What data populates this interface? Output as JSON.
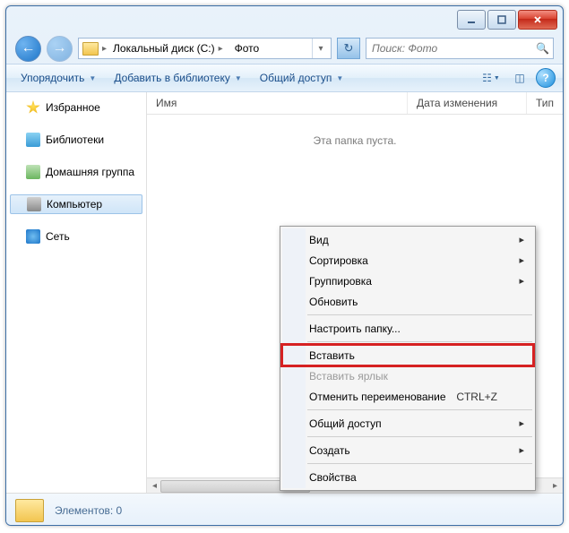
{
  "window": {
    "title": ""
  },
  "nav": {
    "crumbs": [
      {
        "label": "Локальный диск (C:)"
      },
      {
        "label": "Фото"
      }
    ],
    "search_placeholder": "Поиск: Фото"
  },
  "toolbar": {
    "organize_label": "Упорядочить",
    "addlib_label": "Добавить в библиотеку",
    "share_label": "Общий доступ"
  },
  "sidebar": {
    "items": [
      {
        "label": "Избранное",
        "icon": "fav"
      },
      {
        "label": "Библиотеки",
        "icon": "lib"
      },
      {
        "label": "Домашняя группа",
        "icon": "home"
      },
      {
        "label": "Компьютер",
        "icon": "comp",
        "selected": true
      },
      {
        "label": "Сеть",
        "icon": "net"
      }
    ]
  },
  "columns": {
    "name": "Имя",
    "date": "Дата изменения",
    "type": "Тип"
  },
  "content": {
    "empty_text": "Эта папка пуста."
  },
  "statusbar": {
    "text": "Элементов: 0"
  },
  "context_menu": {
    "items": [
      {
        "label": "Вид",
        "submenu": true
      },
      {
        "label": "Сортировка",
        "submenu": true
      },
      {
        "label": "Группировка",
        "submenu": true
      },
      {
        "label": "Обновить"
      },
      {
        "sep": true
      },
      {
        "label": "Настроить папку..."
      },
      {
        "sep": true
      },
      {
        "label": "Вставить",
        "highlight": true
      },
      {
        "label": "Вставить ярлык",
        "disabled": true
      },
      {
        "label": "Отменить переименование",
        "shortcut": "CTRL+Z"
      },
      {
        "sep": true
      },
      {
        "label": "Общий доступ",
        "submenu": true
      },
      {
        "sep": true
      },
      {
        "label": "Создать",
        "submenu": true
      },
      {
        "sep": true
      },
      {
        "label": "Свойства"
      }
    ]
  }
}
